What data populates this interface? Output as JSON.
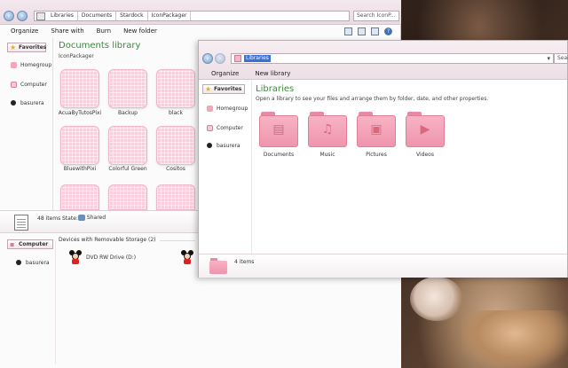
{
  "window_back": {
    "address": {
      "crumbs": [
        "Libraries",
        "Documents",
        "Stardock",
        "IconPackager"
      ],
      "search_placeholder": "Search IconP..."
    },
    "toolbar": {
      "organize": "Organize",
      "share_with": "Share with",
      "burn": "Burn",
      "new_folder": "New folder"
    },
    "sidebar": {
      "favorites": "Favorites",
      "homegroup": "Homegroup",
      "computer": "Computer",
      "user": "basurera"
    },
    "library": {
      "title": "Documents library",
      "subtitle": "IconPackager"
    },
    "items": [
      {
        "label": "AcuaByTutosPixi"
      },
      {
        "label": "Backup"
      },
      {
        "label": "black"
      },
      {
        "label": "BluewithPixi"
      },
      {
        "label": "Colorful Green"
      },
      {
        "label": "Cositos"
      },
      {
        "label": ""
      },
      {
        "label": ""
      },
      {
        "label": ""
      }
    ],
    "details": {
      "count": "48 items",
      "state_label": "State:",
      "state_value": "Shared"
    },
    "bottom": {
      "computer": "Computer",
      "user": "basurera",
      "section": "Devices with Removable Storage (2)",
      "drive": "DVD RW Drive (D:)"
    }
  },
  "window_front": {
    "address": {
      "path": "Libraries",
      "search_placeholder": "Search"
    },
    "toolbar": {
      "organize": "Organize",
      "new_library": "New library"
    },
    "sidebar": {
      "favorites": "Favorites",
      "homegroup": "Homegroup",
      "computer": "Computer",
      "user": "basurera"
    },
    "header": {
      "title": "Libraries",
      "subtitle": "Open a library to see your files and arrange them by folder, date, and other properties."
    },
    "libraries": [
      {
        "label": "Documents",
        "icon": "document-icon"
      },
      {
        "label": "Music",
        "icon": "music-icon"
      },
      {
        "label": "Pictures",
        "icon": "pictures-icon"
      },
      {
        "label": "Videos",
        "icon": "videos-icon"
      }
    ],
    "details": {
      "count": "4 items"
    }
  },
  "colors": {
    "accent_green": "#3c8a3c",
    "folder_pink": "#f7b3c4",
    "selection_blue": "#3a6fd8"
  }
}
